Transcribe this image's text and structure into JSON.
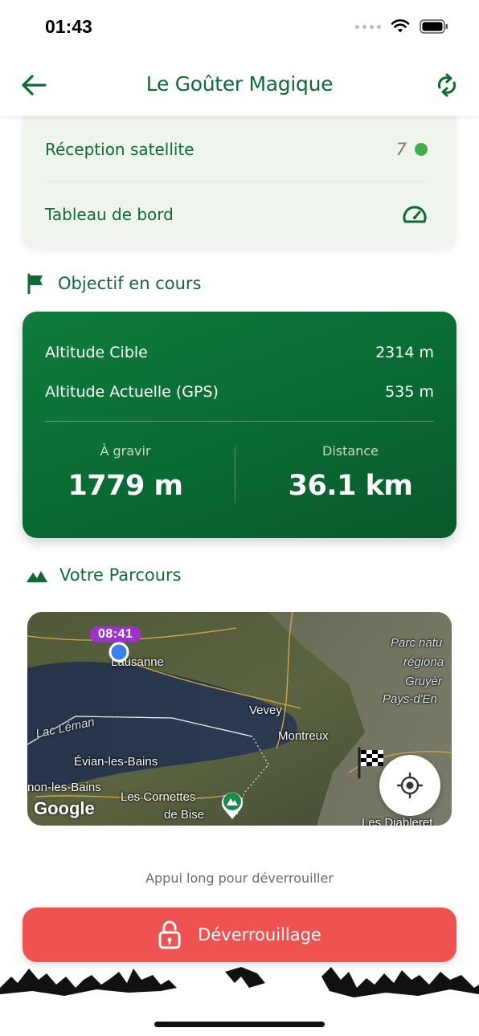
{
  "status_bar": {
    "time": "01:43"
  },
  "header": {
    "title": "Le Goûter Magique",
    "back_icon": "arrow-left-icon",
    "refresh_icon": "refresh-icon"
  },
  "info_card": {
    "satellite_label": "Réception satellite",
    "satellite_count": "7",
    "satellite_status_color": "#3fae4b",
    "dashboard_label": "Tableau de bord",
    "dashboard_icon": "speedometer-icon"
  },
  "objective": {
    "section_title": "Objectif en cours",
    "section_icon": "flag-icon",
    "target_altitude_label": "Altitude Cible",
    "target_altitude_value": "2314 m",
    "current_altitude_label": "Altitude Actuelle (GPS)",
    "current_altitude_value": "535 m",
    "climb_label": "À gravir",
    "climb_value": "1779 m",
    "distance_label": "Distance",
    "distance_value": "36.1 km"
  },
  "route": {
    "section_title": "Votre Parcours",
    "section_icon": "mountains-icon",
    "map": {
      "time_badge": "08:41",
      "places": [
        "Lausanne",
        "Vevey",
        "Montreux",
        "Lac Léman",
        "Évian-les-Bains",
        "non-les-Bains",
        "Les Cornettes",
        "de Bise",
        "Parc natu",
        "régiona",
        "Gruyèr",
        "Pays-d'En",
        "Les Diableret"
      ],
      "attribution": "Google",
      "locate_icon": "crosshair-icon"
    }
  },
  "unlock": {
    "hint": "Appui long pour déverrouiller",
    "button_label": "Déverrouillage",
    "button_icon": "lock-open-icon",
    "button_color": "#ee5351"
  },
  "colors": {
    "brand_green": "#0e6b34",
    "card_bg": "#eff4ec",
    "route_badge": "#9a33c7"
  }
}
